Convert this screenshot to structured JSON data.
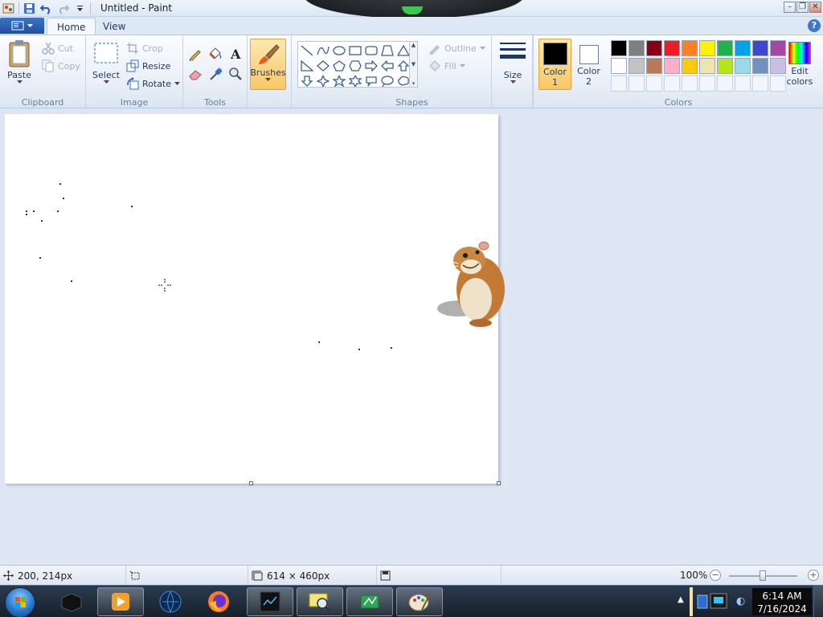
{
  "window": {
    "title": "Untitled - Paint"
  },
  "tabs": {
    "home": "Home",
    "view": "View"
  },
  "clipboard": {
    "group": "Clipboard",
    "paste": "Paste",
    "cut": "Cut",
    "copy": "Copy"
  },
  "image": {
    "group": "Image",
    "select": "Select",
    "crop": "Crop",
    "resize": "Resize",
    "rotate": "Rotate"
  },
  "tools": {
    "group": "Tools"
  },
  "brushes": {
    "label": "Brushes"
  },
  "shapes": {
    "group": "Shapes",
    "outline": "Outline",
    "fill": "Fill"
  },
  "size": {
    "label": "Size"
  },
  "colors": {
    "group": "Colors",
    "color1_line1": "Color",
    "color1_line2": "1",
    "color2_line1": "Color",
    "color2_line2": "2",
    "edit_line1": "Edit",
    "edit_line2": "colors",
    "color1": "#000000",
    "color2": "#ffffff",
    "palette_row1": [
      "#000000",
      "#7f7f7f",
      "#880015",
      "#ed1c24",
      "#ff7f27",
      "#fff200",
      "#22b14c",
      "#00a2e8",
      "#3f48cc",
      "#a349a4"
    ],
    "palette_row2": [
      "#ffffff",
      "#c3c3c3",
      "#b97a57",
      "#ffaec9",
      "#ffc90e",
      "#efe4b0",
      "#b5e61d",
      "#99d9ea",
      "#7092be",
      "#c8bfe7"
    ]
  },
  "status": {
    "cursor_pos": "200, 214px",
    "canvas_size": "614 × 460px",
    "zoom": "100%"
  },
  "taskbar": {
    "time": "6:14 AM",
    "date": "7/16/2024"
  }
}
